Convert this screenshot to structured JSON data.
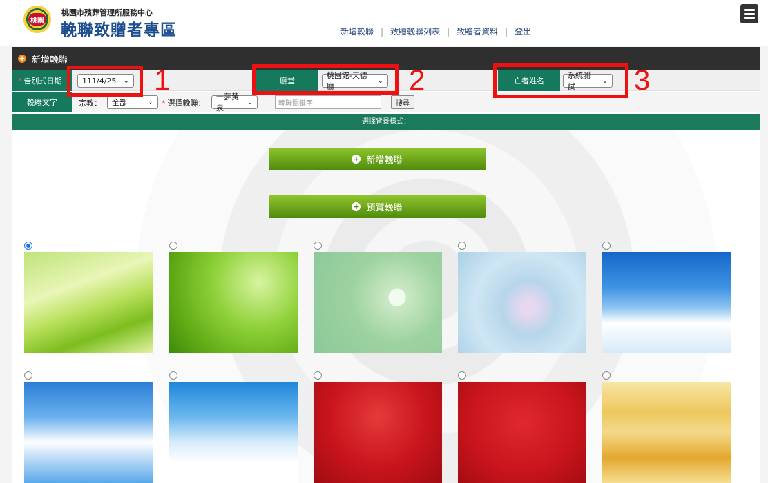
{
  "header": {
    "seal_text": "桃園",
    "org_name": "桃園市殯葬管理所服務中心",
    "site_title": "輓聯致贈者專區",
    "nav": [
      "新增輓聯",
      "致贈輓聯列表",
      "致贈者資料",
      "登出"
    ]
  },
  "panel": {
    "title": "新增輓聯"
  },
  "form": {
    "date_label": "告別式日期",
    "date_value": "111/4/25",
    "hall_label": "廳堂",
    "hall_value": "桃園館-天德廳",
    "deceased_label": "亡者姓名",
    "deceased_value": "系統測試",
    "elegy_text_label": "輓聯文字",
    "religion_label": "宗教：",
    "religion_value": "全部",
    "choose_label": "選擇輓聯：",
    "choose_value": "一夢黃泉",
    "keyword_placeholder": "輓聯關鍵字",
    "search_label": "搜尋"
  },
  "background_section": {
    "title": "選擇背景樣式：",
    "add_button": "新增輓聯",
    "preview_button": "預覽輓聯"
  },
  "backgrounds": [
    {
      "name": "green-light",
      "selected": true
    },
    {
      "name": "green-bokeh",
      "selected": false
    },
    {
      "name": "lotus-green",
      "selected": false
    },
    {
      "name": "lotus-blue",
      "selected": false
    },
    {
      "name": "sky-birds",
      "selected": false
    },
    {
      "name": "sky-clouds",
      "selected": false
    },
    {
      "name": "sky-plum",
      "selected": false
    },
    {
      "name": "red-pattern",
      "selected": false
    },
    {
      "name": "red-damask",
      "selected": false
    },
    {
      "name": "gold-mist",
      "selected": false
    }
  ],
  "annotations": [
    "1",
    "2",
    "3"
  ],
  "colors": {
    "panel_dark": "#2f2f2f",
    "label_green": "#157a5d",
    "button_green": "#6aa51c",
    "annotation_red": "#ee1111",
    "title_blue": "#1e4f8f"
  },
  "icons": [
    "hamburger-menu-icon",
    "plus-circle-icon"
  ]
}
